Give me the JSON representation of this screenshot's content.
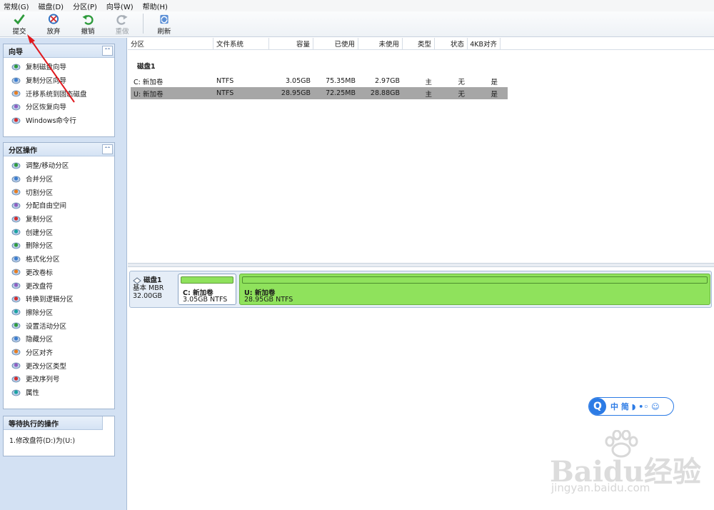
{
  "menu": [
    "常规(G)",
    "磁盘(D)",
    "分区(P)",
    "向导(W)",
    "帮助(H)"
  ],
  "toolbar": {
    "submit": "提交",
    "discard": "放弃",
    "undo": "撤销",
    "redo": "重做",
    "refresh": "刷新"
  },
  "wizard_panel": {
    "title": "向导",
    "items": [
      "复制磁盘向导",
      "复制分区向导",
      "迁移系统到固态磁盘",
      "分区恢复向导",
      "Windows命令行"
    ]
  },
  "ops_panel": {
    "title": "分区操作",
    "items": [
      "调整/移动分区",
      "合并分区",
      "切割分区",
      "分配自由空间",
      "复制分区",
      "创建分区",
      "删除分区",
      "格式化分区",
      "更改卷标",
      "更改盘符",
      "转换到逻辑分区",
      "擦除分区",
      "设置活动分区",
      "隐藏分区",
      "分区对齐",
      "更改分区类型",
      "更改序列号",
      "属性"
    ]
  },
  "pending_panel": {
    "title": "等待执行的操作",
    "items": [
      "1.修改盘符(D:)为(U:)"
    ]
  },
  "table": {
    "headers": [
      "分区",
      "文件系统",
      "容量",
      "已使用",
      "未使用",
      "类型",
      "状态",
      "4KB对齐"
    ],
    "disk_label": "磁盘1",
    "rows": [
      {
        "name": "C: 新加卷",
        "fs": "NTFS",
        "capacity": "3.05GB",
        "used": "75.35MB",
        "free": "2.97GB",
        "type": "主",
        "status": "无",
        "aligned": "是"
      },
      {
        "name": "U: 新加卷",
        "fs": "NTFS",
        "capacity": "28.95GB",
        "used": "72.25MB",
        "free": "28.88GB",
        "type": "主",
        "status": "无",
        "aligned": "是"
      }
    ]
  },
  "disk_map": {
    "disk_name": "磁盘1",
    "disk_type": "基本 MBR",
    "disk_size": "32.00GB",
    "partitions": [
      {
        "name": "C: 新加卷",
        "info": "3.05GB NTFS"
      },
      {
        "name": "U: 新加卷",
        "info": "28.95GB NTFS"
      }
    ]
  },
  "ime": {
    "logo": "Q",
    "text": "中 简 ◗ •◦ ☺"
  },
  "watermark": {
    "brand": "Baidu经验",
    "url": "jingyan.baidu.com"
  },
  "colors": {
    "sidebar_bg": "#d3e1f3",
    "partition_green": "#8fe25c",
    "selected_row": "#a6a6a6",
    "ime_blue": "#2c7be5",
    "arrow_red": "#e0191e"
  }
}
